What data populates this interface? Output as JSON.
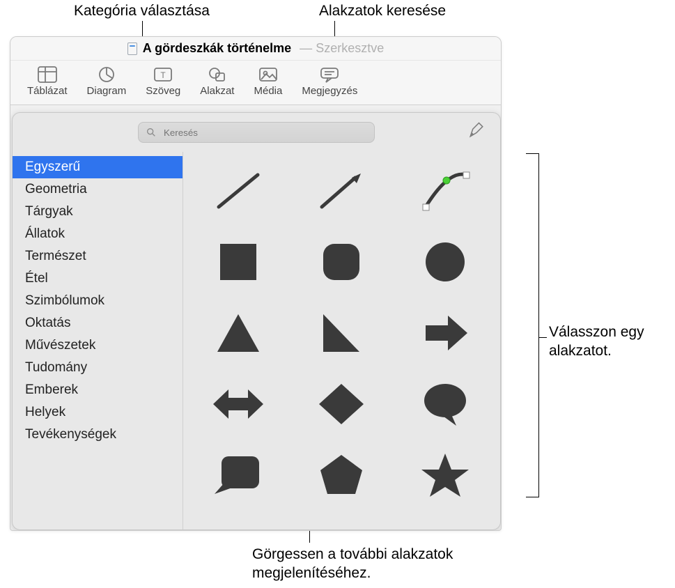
{
  "callouts": {
    "category": "Kategória választása",
    "search": "Alakzatok keresése",
    "choose": "Válasszon egy alakzatot.",
    "scroll": "Görgessen a további alakzatok megjelenítéséhez."
  },
  "titlebar": {
    "doc_title": "A gördeszkák történelme",
    "status": "Szerkesztve"
  },
  "toolbar": {
    "table": "Táblázat",
    "chart": "Diagram",
    "text": "Szöveg",
    "shape": "Alakzat",
    "media": "Média",
    "comment": "Megjegyzés"
  },
  "search": {
    "placeholder": "Keresés"
  },
  "sidebar": {
    "items": [
      {
        "label": "Egyszerű",
        "selected": true
      },
      {
        "label": "Geometria",
        "selected": false
      },
      {
        "label": "Tárgyak",
        "selected": false
      },
      {
        "label": "Állatok",
        "selected": false
      },
      {
        "label": "Természet",
        "selected": false
      },
      {
        "label": "Étel",
        "selected": false
      },
      {
        "label": "Szimbólumok",
        "selected": false
      },
      {
        "label": "Oktatás",
        "selected": false
      },
      {
        "label": "Művészetek",
        "selected": false
      },
      {
        "label": "Tudomány",
        "selected": false
      },
      {
        "label": "Emberek",
        "selected": false
      },
      {
        "label": "Helyek",
        "selected": false
      },
      {
        "label": "Tevékenységek",
        "selected": false
      }
    ]
  },
  "shapes": [
    "line",
    "arrow-line",
    "curve",
    "square",
    "rounded-square",
    "circle",
    "triangle",
    "right-triangle",
    "arrow-right",
    "arrow-bidir",
    "diamond",
    "speech-bubble",
    "callout-rect",
    "pentagon",
    "star"
  ]
}
